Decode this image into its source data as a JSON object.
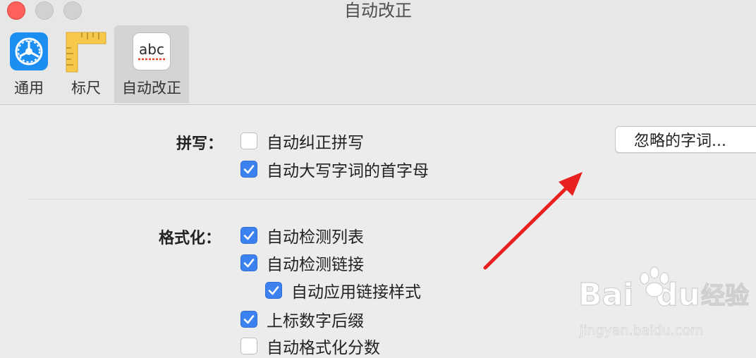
{
  "window": {
    "title": "自动改正"
  },
  "toolbar": {
    "tabs": [
      {
        "label": "通用",
        "icon": "gear-icon"
      },
      {
        "label": "标尺",
        "icon": "ruler-icon"
      },
      {
        "label": "自动改正",
        "icon": "abc-spellcheck-icon"
      }
    ],
    "selected_tab": "自动改正"
  },
  "spelling": {
    "label": "拼写：",
    "options": [
      {
        "label": "自动纠正拼写",
        "checked": false
      },
      {
        "label": "自动大写字词的首字母",
        "checked": true
      }
    ],
    "ignored_words_button": "忽略的字词..."
  },
  "formatting": {
    "label": "格式化：",
    "options": [
      {
        "label": "自动检测列表",
        "checked": true
      },
      {
        "label": "自动检测链接",
        "checked": true
      },
      {
        "label": "自动应用链接样式",
        "checked": true
      },
      {
        "label": "上标数字后缀",
        "checked": true
      },
      {
        "label": "自动格式化分数",
        "checked": false
      }
    ]
  },
  "watermark": {
    "brand": "Bai",
    "brand2": "du",
    "cn": "经验",
    "url": "jingyan.baidu.com"
  },
  "colors": {
    "accent": "#3b82f0",
    "close": "#fc615d",
    "annotation_arrow": "#e8201f"
  }
}
